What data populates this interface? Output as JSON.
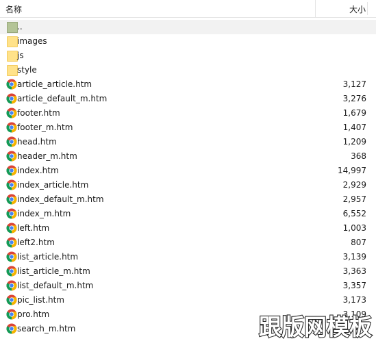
{
  "columns": {
    "name": "名称",
    "size": "大小"
  },
  "rows": [
    {
      "name": "..",
      "size": "",
      "icon": "parent-folder-icon"
    },
    {
      "name": "images",
      "size": "",
      "icon": "folder-icon"
    },
    {
      "name": "js",
      "size": "",
      "icon": "folder-icon"
    },
    {
      "name": "style",
      "size": "",
      "icon": "folder-icon"
    },
    {
      "name": "article_article.htm",
      "size": "3,127",
      "icon": "chrome-icon"
    },
    {
      "name": "article_default_m.htm",
      "size": "3,276",
      "icon": "chrome-icon"
    },
    {
      "name": "footer.htm",
      "size": "1,679",
      "icon": "chrome-icon"
    },
    {
      "name": "footer_m.htm",
      "size": "1,407",
      "icon": "chrome-icon"
    },
    {
      "name": "head.htm",
      "size": "1,209",
      "icon": "chrome-icon"
    },
    {
      "name": "header_m.htm",
      "size": "368",
      "icon": "chrome-icon"
    },
    {
      "name": "index.htm",
      "size": "14,997",
      "icon": "chrome-icon"
    },
    {
      "name": "index_article.htm",
      "size": "2,929",
      "icon": "chrome-icon"
    },
    {
      "name": "index_default_m.htm",
      "size": "2,957",
      "icon": "chrome-icon"
    },
    {
      "name": "index_m.htm",
      "size": "6,552",
      "icon": "chrome-icon"
    },
    {
      "name": "left.htm",
      "size": "1,003",
      "icon": "chrome-icon"
    },
    {
      "name": "left2.htm",
      "size": "807",
      "icon": "chrome-icon"
    },
    {
      "name": "list_article.htm",
      "size": "3,139",
      "icon": "chrome-icon"
    },
    {
      "name": "list_article_m.htm",
      "size": "3,363",
      "icon": "chrome-icon"
    },
    {
      "name": "list_default_m.htm",
      "size": "3,357",
      "icon": "chrome-icon"
    },
    {
      "name": "pic_list.htm",
      "size": "3,173",
      "icon": "chrome-icon"
    },
    {
      "name": "pro.htm",
      "size": "3,109",
      "icon": "chrome-icon"
    },
    {
      "name": "search_m.htm",
      "size": "",
      "icon": "chrome-icon"
    }
  ],
  "watermark": "跟版网模板",
  "colors": {
    "folder": "#ffe28a",
    "parent_folder": "#b4c497",
    "selected_row": "#f2f2f2",
    "header_border": "#e5e5e5"
  }
}
